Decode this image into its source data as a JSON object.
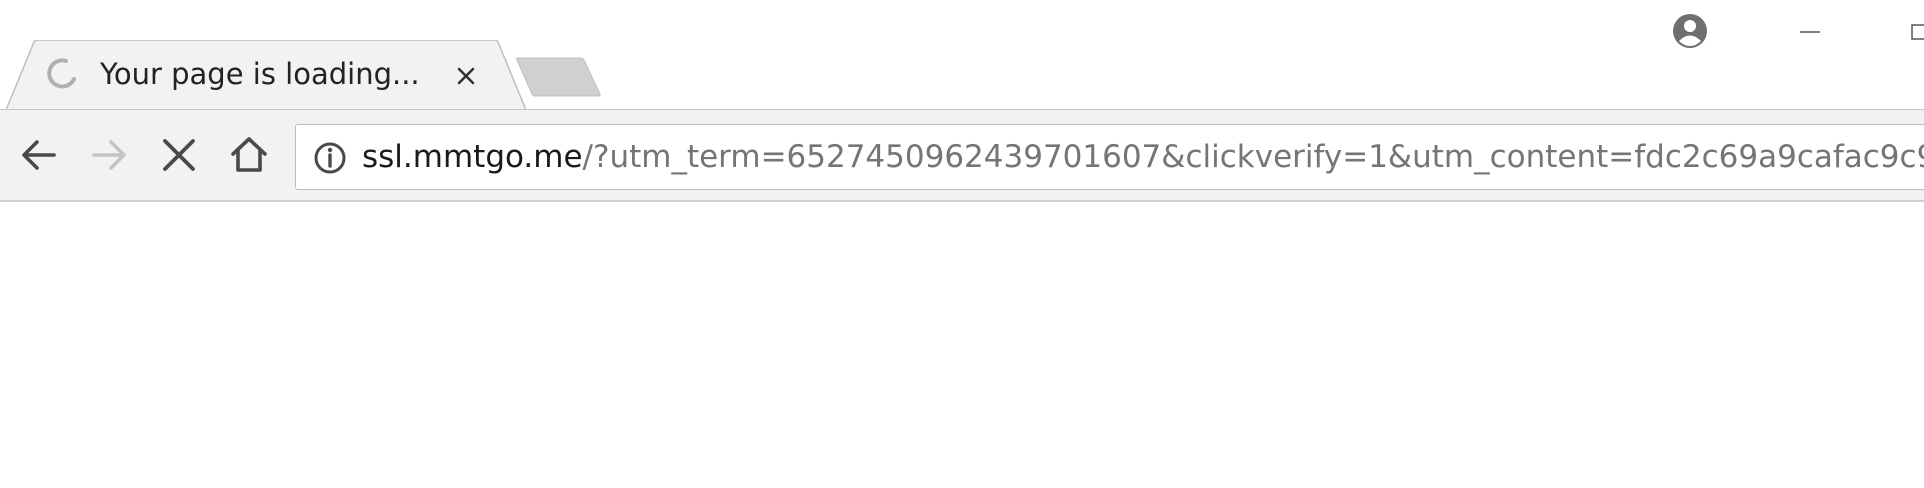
{
  "window": {
    "controls": {
      "profile_icon": "account-circle-icon",
      "minimize_icon": "minimize-icon",
      "maximize_icon": "maximize-icon"
    }
  },
  "tabs": [
    {
      "title": "Your page is loading...",
      "state": "loading",
      "spinner_icon": "loading-spinner-icon",
      "close_icon": "close-icon",
      "active": true
    }
  ],
  "new_tab": {
    "icon": "new-tab-icon"
  },
  "toolbar": {
    "back_icon": "back-arrow-icon",
    "forward_icon": "forward-arrow-icon",
    "forward_enabled": false,
    "stop_icon": "stop-icon",
    "home_icon": "home-icon"
  },
  "omnibox": {
    "security_icon": "info-icon",
    "url_host": "ssl.mmtgo.me",
    "url_rest": "/?utm_term=6527450962439701607&clickverify=1&utm_content=fdc2c69a9cafac9c9..."
  },
  "colors": {
    "toolbar_bg": "#f2f2f2",
    "tab_bg": "#f2f2f2",
    "inactive_tab_bg": "#d0d0d0",
    "icon_color": "#5a5a5a",
    "disabled_icon_color": "#c4c4c4",
    "url_host_color": "#1a1a1a",
    "url_path_color": "#757575"
  }
}
